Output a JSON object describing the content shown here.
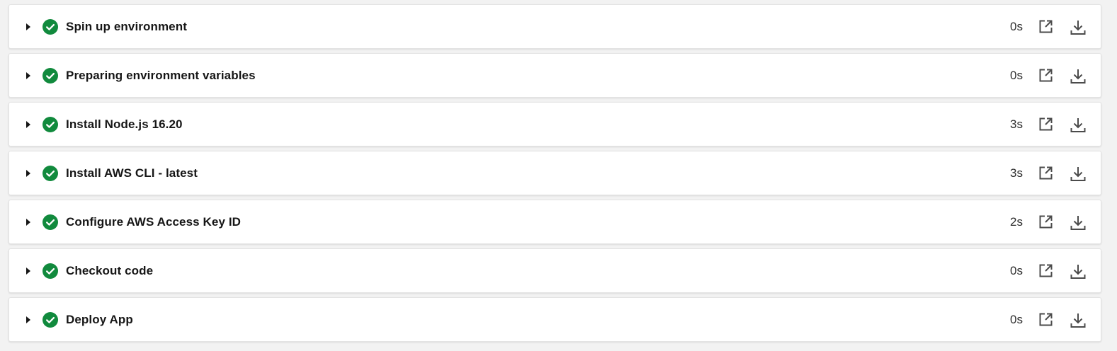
{
  "colors": {
    "success": "#118a3d",
    "text": "#161616",
    "icon": "#4b4b4b"
  },
  "steps": [
    {
      "title": "Spin up environment",
      "duration": "0s",
      "status_icon": "check-circle-icon"
    },
    {
      "title": "Preparing environment variables",
      "duration": "0s",
      "status_icon": "check-circle-icon"
    },
    {
      "title": "Install Node.js 16.20",
      "duration": "3s",
      "status_icon": "check-circle-icon"
    },
    {
      "title": "Install AWS CLI - latest",
      "duration": "3s",
      "status_icon": "check-circle-icon"
    },
    {
      "title": "Configure AWS Access Key ID",
      "duration": "2s",
      "status_icon": "check-circle-icon"
    },
    {
      "title": "Checkout code",
      "duration": "0s",
      "status_icon": "check-circle-icon"
    },
    {
      "title": "Deploy App",
      "duration": "0s",
      "status_icon": "check-circle-icon"
    }
  ],
  "row_actions": {
    "expand_icon": "caret-right-icon",
    "open_icon": "open-in-new-icon",
    "download_icon": "download-icon"
  }
}
